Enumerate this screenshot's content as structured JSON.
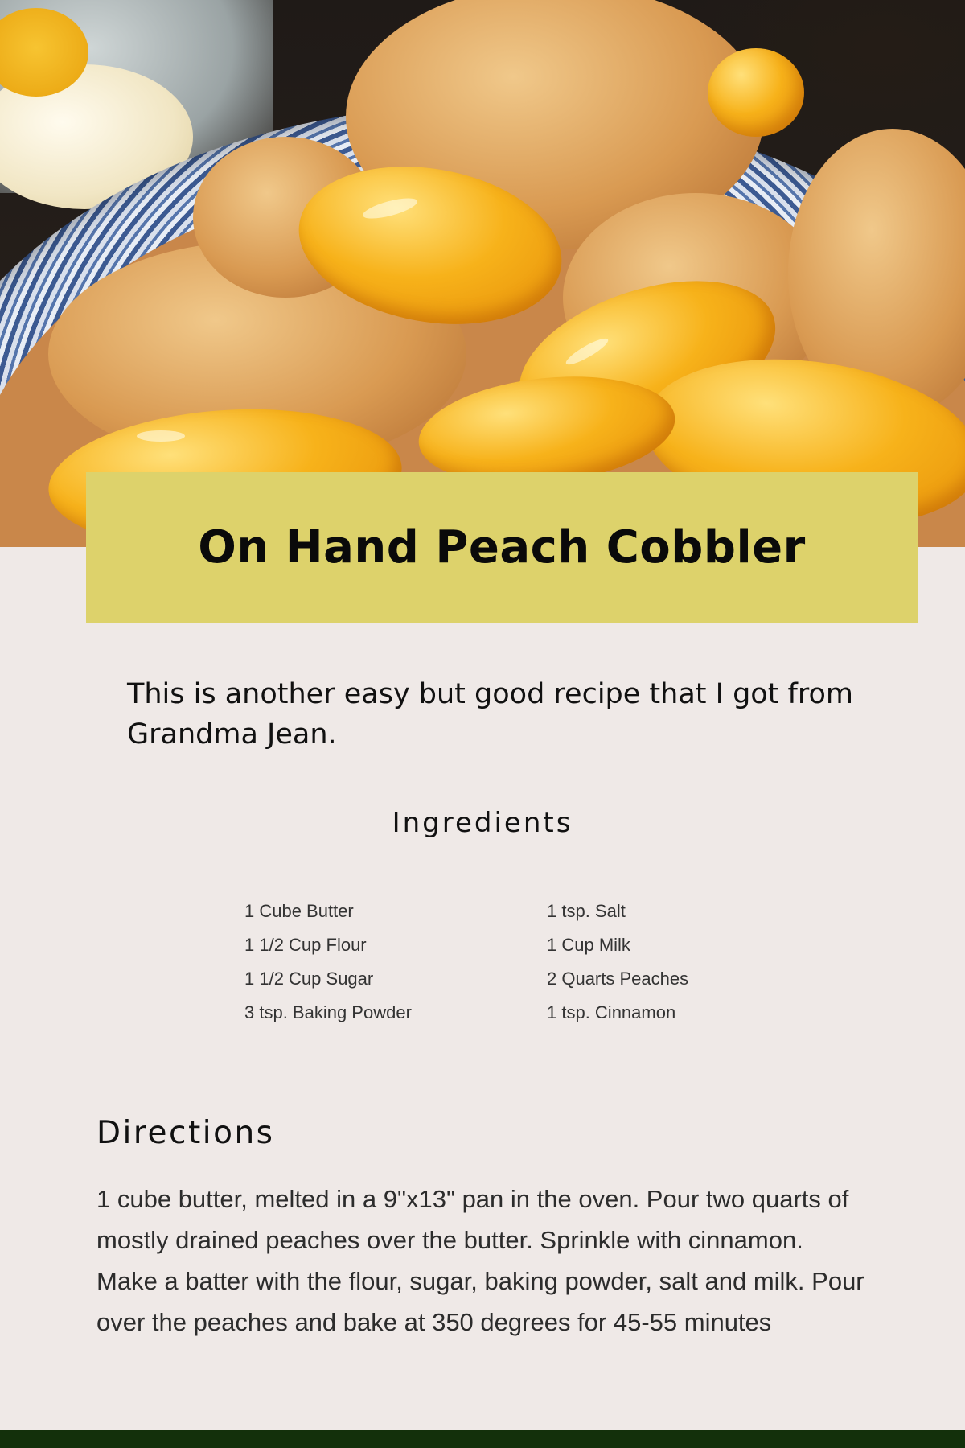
{
  "page": {
    "background_color": "#efe9e7",
    "accent_color": "#ddd26b",
    "footer_color": "#13300b"
  },
  "hero": {
    "image": "peach-cobbler-photo"
  },
  "recipe": {
    "title": "On Hand Peach Cobbler",
    "intro": "This is another easy but good recipe that I got from Grandma Jean.",
    "ingredients_heading": "Ingredients",
    "ingredients_left": [
      "1 Cube Butter",
      "1 1/2 Cup Flour",
      "1 1/2 Cup Sugar",
      "3 tsp. Baking Powder"
    ],
    "ingredients_right": [
      "1 tsp. Salt",
      "1 Cup Milk",
      "2 Quarts Peaches",
      "1 tsp. Cinnamon"
    ],
    "directions_heading": "Directions",
    "directions_text": "1 cube butter, melted in a 9\"x13\" pan in the oven. Pour two quarts of mostly drained peaches over the butter. Sprinkle with cinnamon. Make a batter with the flour, sugar, baking powder, salt and milk. Pour over the peaches and bake at 350 degrees for 45-55 minutes"
  }
}
